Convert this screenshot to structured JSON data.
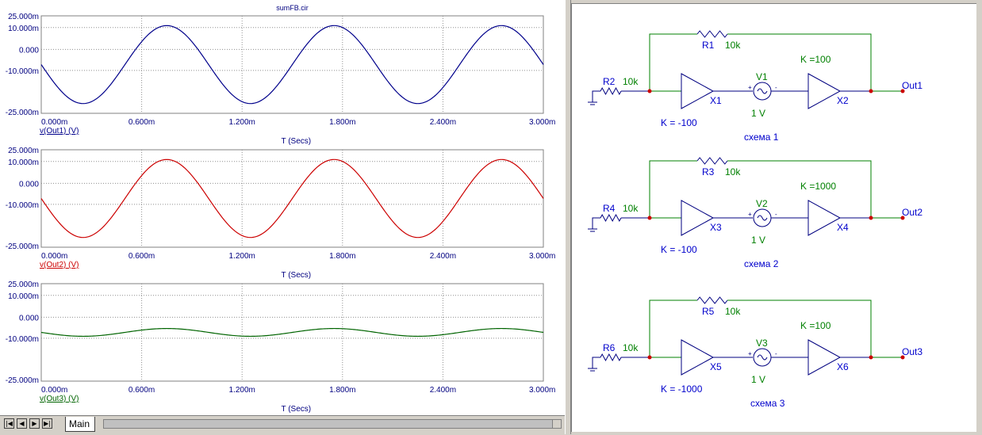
{
  "plot_window": {
    "title": "sumFB.cir",
    "tab_label": "Main",
    "nav_buttons": [
      "first",
      "prev",
      "next",
      "last"
    ]
  },
  "chart_data": [
    {
      "type": "line",
      "title": "sumFB.cir",
      "series": [
        {
          "name": "v(Out1) (V)",
          "amplitude": 20,
          "color": "#00008b"
        }
      ],
      "xlabel": "T (Secs)",
      "xlim": [
        0,
        3.0
      ],
      "ylim": [
        -25,
        25
      ],
      "x_ticks": [
        "0.000m",
        "0.600m",
        "1.200m",
        "1.800m",
        "2.400m",
        "3.000m"
      ],
      "y_ticks": [
        "25.000m",
        "10.000m",
        "0.000",
        "-10.000m",
        "-25.000m"
      ],
      "grid": true
    },
    {
      "type": "line",
      "series": [
        {
          "name": "v(Out2) (V)",
          "amplitude": 20,
          "color": "#cc0000"
        }
      ],
      "xlabel": "T (Secs)",
      "xlim": [
        0,
        3.0
      ],
      "ylim": [
        -25,
        25
      ],
      "x_ticks": [
        "0.000m",
        "0.600m",
        "1.200m",
        "1.800m",
        "2.400m",
        "3.000m"
      ],
      "y_ticks": [
        "25.000m",
        "10.000m",
        "0.000",
        "-10.000m",
        "-25.000m"
      ],
      "grid": true
    },
    {
      "type": "line",
      "series": [
        {
          "name": "v(Out3) (V)",
          "amplitude": 2,
          "color": "#006400"
        }
      ],
      "xlabel": "T (Secs)",
      "xlim": [
        0,
        3.0
      ],
      "ylim": [
        -25,
        25
      ],
      "x_ticks": [
        "0.000m",
        "0.600m",
        "1.200m",
        "1.800m",
        "2.400m",
        "3.000m"
      ],
      "y_ticks": [
        "25.000m",
        "10.000m",
        "0.000",
        "-10.000m",
        "-25.000m"
      ],
      "grid": true
    }
  ],
  "schematic": {
    "circuits": [
      {
        "feedback_resistor": "R1",
        "feedback_value": "10k",
        "input_resistor": "R2",
        "input_value": "10k",
        "amp1": "X1",
        "amp1_gain": "K =  -100",
        "source": "V1",
        "source_value": "1 V",
        "amp2": "X2",
        "amp2_gain": "K =100",
        "output": "Out1",
        "caption": "схема 1"
      },
      {
        "feedback_resistor": "R3",
        "feedback_value": "10k",
        "input_resistor": "R4",
        "input_value": "10k",
        "amp1": "X3",
        "amp1_gain": "K =  -100",
        "source": "V2",
        "source_value": "1 V",
        "amp2": "X4",
        "amp2_gain": "K =1000",
        "output": "Out2",
        "caption": "схема 2"
      },
      {
        "feedback_resistor": "R5",
        "feedback_value": "10k",
        "input_resistor": "R6",
        "input_value": "10k",
        "amp1": "X5",
        "amp1_gain": "K =  -1000",
        "source": "V3",
        "source_value": "1 V",
        "amp2": "X6",
        "amp2_gain": "K =100",
        "output": "Out3",
        "caption": "схема 3"
      }
    ]
  },
  "colors": {
    "wire": "#008000",
    "component": "#000080",
    "label_blue": "#0000cc",
    "label_green": "#008000",
    "junction": "#cc0000"
  }
}
